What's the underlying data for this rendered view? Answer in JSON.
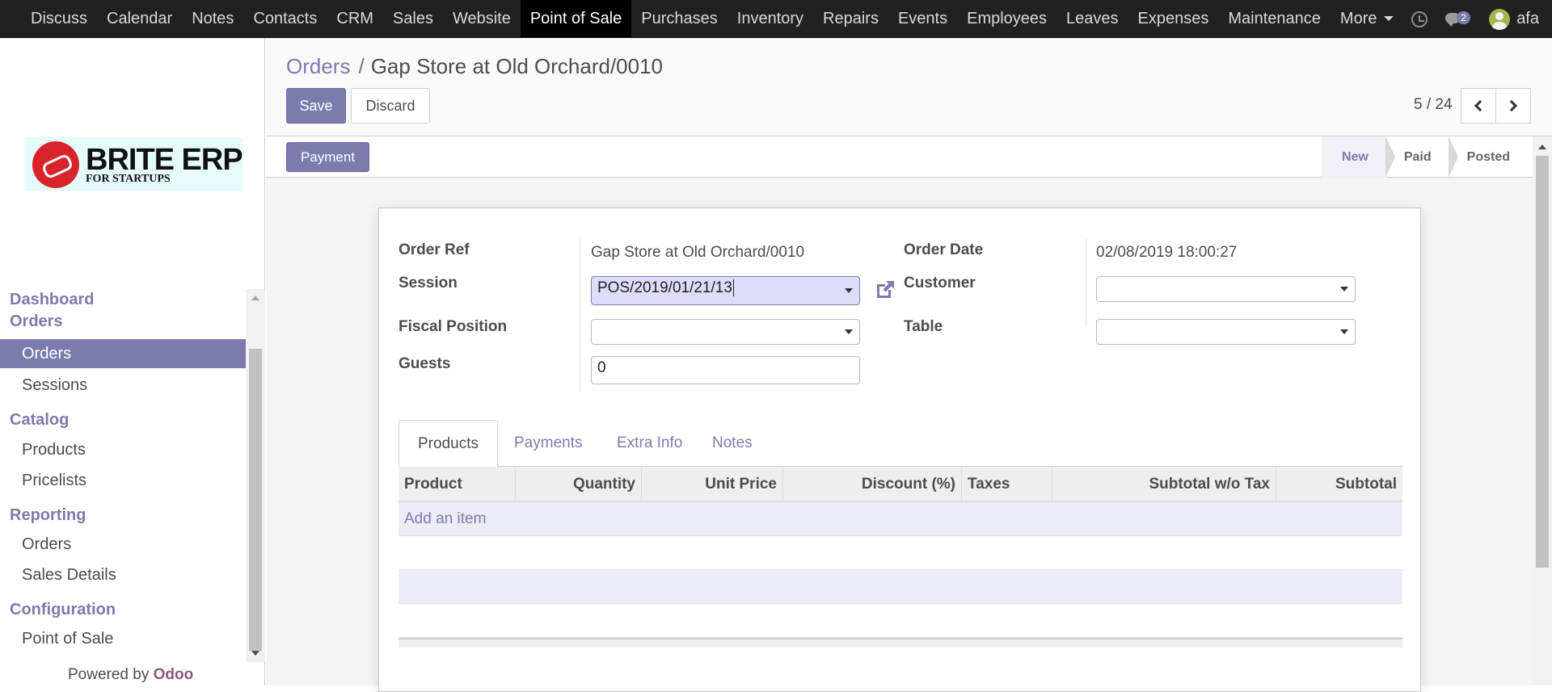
{
  "topnav": {
    "apps": [
      "Discuss",
      "Calendar",
      "Notes",
      "Contacts",
      "CRM",
      "Sales",
      "Website",
      "Point of Sale",
      "Purchases",
      "Inventory",
      "Repairs",
      "Events",
      "Employees",
      "Leaves",
      "Expenses",
      "Maintenance"
    ],
    "active_app": "Point of Sale",
    "more_label": "More",
    "chat_count": "2",
    "user_name": "afa"
  },
  "sidebar": {
    "logo_line1": "BRITE ERP",
    "logo_line2": "FOR STARTUPS",
    "sections": [
      {
        "title": "Dashboard",
        "items": []
      },
      {
        "title": "Orders",
        "items": [
          "Orders",
          "Sessions"
        ]
      },
      {
        "title": "Catalog",
        "items": [
          "Products",
          "Pricelists"
        ]
      },
      {
        "title": "Reporting",
        "items": [
          "Orders",
          "Sales Details"
        ]
      },
      {
        "title": "Configuration",
        "items": [
          "Point of Sale"
        ]
      }
    ],
    "active_item": "Orders",
    "powered_by": "Powered by",
    "powered_brand": "Odoo"
  },
  "breadcrumb": {
    "parent": "Orders",
    "separator": "/",
    "current": "Gap Store at Old Orchard/0010"
  },
  "actions": {
    "save": "Save",
    "discard": "Discard"
  },
  "pager": {
    "value": "5 / 24"
  },
  "statusbar": {
    "payment_button": "Payment",
    "stages": [
      "New",
      "Paid",
      "Posted"
    ],
    "current_stage": "New"
  },
  "form": {
    "order_ref_label": "Order Ref",
    "order_ref_value": "Gap Store at Old Orchard/0010",
    "session_label": "Session",
    "session_value": "POS/2019/01/21/13",
    "fiscal_position_label": "Fiscal Position",
    "fiscal_position_value": "",
    "guests_label": "Guests",
    "guests_value": "0",
    "order_date_label": "Order Date",
    "order_date_value": "02/08/2019 18:00:27",
    "customer_label": "Customer",
    "customer_value": "",
    "table_label": "Table",
    "table_value": ""
  },
  "tabs": [
    "Products",
    "Payments",
    "Extra Info",
    "Notes"
  ],
  "active_tab": "Products",
  "lines_table": {
    "columns": [
      "Product",
      "Quantity",
      "Unit Price",
      "Discount (%)",
      "Taxes",
      "Subtotal w/o Tax",
      "Subtotal"
    ],
    "add_item": "Add an item",
    "rows": []
  },
  "colors": {
    "brand": "#7c7bad",
    "topbar": "#212121",
    "odoo": "#875a7b"
  }
}
